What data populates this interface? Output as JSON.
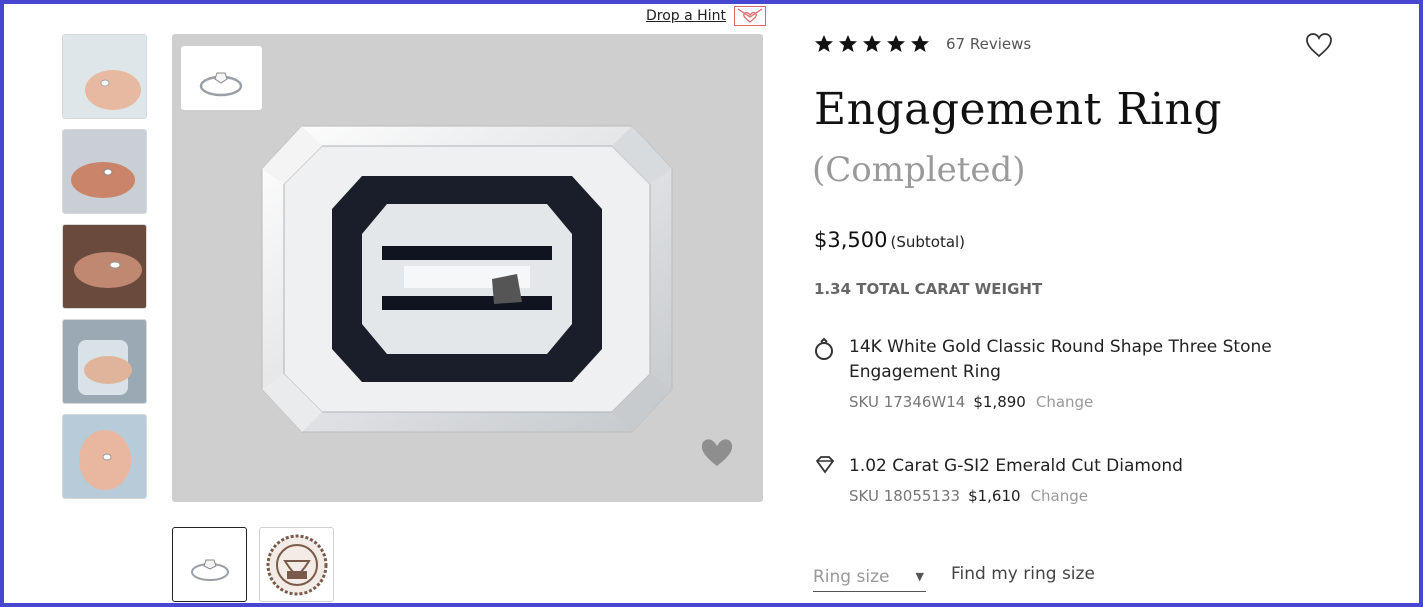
{
  "hint": {
    "label": "Drop a Hint"
  },
  "thumbnails": [
    {
      "alt": "hand-with-ring-photo-1"
    },
    {
      "alt": "hand-with-ring-photo-2"
    },
    {
      "alt": "hand-with-ring-photo-3"
    },
    {
      "alt": "hand-with-ring-photo-4"
    },
    {
      "alt": "hand-with-ring-photo-5"
    }
  ],
  "rating": {
    "stars": 5,
    "reviews_label": "67 Reviews"
  },
  "product": {
    "title": "Engagement Ring",
    "subtitle": "(Completed)",
    "price": "$3,500",
    "price_note": "(Subtotal)",
    "carat_weight": "1.34 TOTAL CARAT WEIGHT"
  },
  "components": [
    {
      "icon": "ring-icon",
      "name": "14K White Gold Classic Round Shape Three Stone Engagement Ring",
      "sku": "SKU 17346W14",
      "price": "$1,890",
      "change_label": "Change"
    },
    {
      "icon": "diamond-icon",
      "name": "1.02 Carat G-SI2 Emerald Cut Diamond",
      "sku": "SKU 18055133",
      "price": "$1,610",
      "change_label": "Change"
    }
  ],
  "ring_size": {
    "placeholder": "Ring size",
    "find_label": "Find my ring size"
  },
  "colors": {
    "frame": "#4747d1",
    "hint_heart": "#e06a6a",
    "muted": "#9a9a9a"
  }
}
